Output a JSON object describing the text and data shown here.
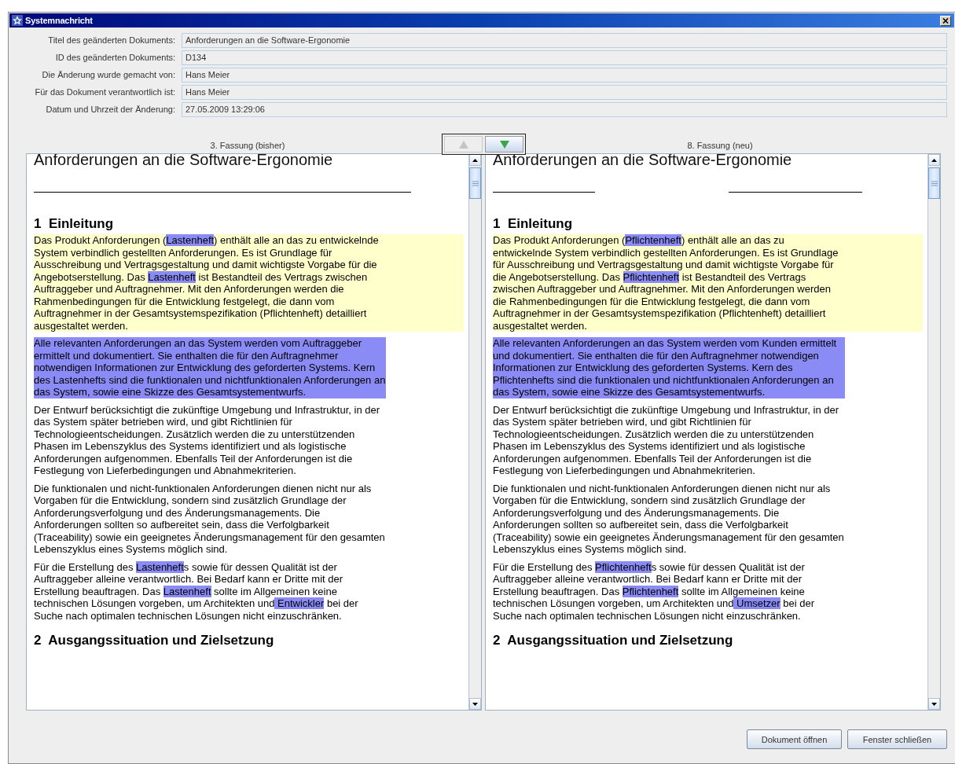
{
  "window": {
    "title": "Systemnachricht"
  },
  "fields": [
    {
      "label": "Titel des geänderten Dokuments:",
      "value": "Anforderungen an die Software-Ergonomie"
    },
    {
      "label": "ID des geänderten Dokuments:",
      "value": "D134"
    },
    {
      "label": "Die Änderung wurde gemacht von:",
      "value": "Hans Meier"
    },
    {
      "label": "Für das Dokument verantwortlich ist:",
      "value": "Hans Meier"
    },
    {
      "label": "Datum und Uhrzeit der Änderung:",
      "value": "27.05.2009 13:29:06"
    }
  ],
  "navigation": {
    "previous": {
      "disabled": true
    },
    "next": {
      "disabled": false
    }
  },
  "versions": [
    {
      "label": "3. Fassung (bisher)",
      "title": "Anforderungen an die Software-Ergonomie",
      "title_rule": {
        "kind": "full"
      },
      "sections": [
        {
          "heading": "1  Einleitung",
          "paragraphs": [
            {
              "kind": "changed",
              "segments": [
                {
                  "text": "Das Produkt Anforderungen (",
                  "marked": false
                },
                {
                  "text": "Lastenheft",
                  "marked": true
                },
                {
                  "text": ") enthält alle an das zu entwickelnde System verbindlich gestellten Anforderungen. Es ist Grundlage für Ausschreibung und Vertragsgestaltung und damit wichtigste Vorgabe für die Angebotserstellung. Das ",
                  "marked": false
                },
                {
                  "text": "Lastenheft",
                  "marked": true
                },
                {
                  "text": " ist Bestandteil des Vertrags zwischen Auftraggeber und Auftragnehmer. Mit den Anforderungen werden die Rahmenbedingungen für die Entwicklung festgelegt, die dann vom Auftragnehmer in der Gesamtsystemspezifikation (Pflichtenheft) detailliert ausgestaltet werden.",
                  "marked": false
                }
              ]
            },
            {
              "kind": "selected",
              "segments": [
                {
                  "text": "Alle relevanten Anforderungen an das System werden vom Auftraggeber ermittelt und dokumentiert. Sie enthalten die für den Auftragnehmer notwendigen Informationen zur Entwicklung des geforderten Systems. Kern des Lastenhefts sind die funktionalen und nichtfunktionalen Anforderungen an das System, sowie eine Skizze des Gesamtsystementwurfs.",
                  "marked": false
                }
              ]
            },
            {
              "kind": "plain",
              "segments": [
                {
                  "text": "Der Entwurf berücksichtigt die zukünftige Umgebung und Infrastruktur, in der das System später betrieben wird, und gibt Richtlinien für Technologieentscheidungen. Zusätzlich werden die zu unterstützenden Phasen im Lebenszyklus des Systems identifiziert und als logistische Anforderungen aufgenommen. Ebenfalls Teil der Anforderungen ist die Festlegung von Lieferbedingungen und Abnahmekriterien.",
                  "marked": false
                }
              ]
            },
            {
              "kind": "plain",
              "segments": [
                {
                  "text": "Die funktionalen und nicht-funktionalen Anforderungen dienen nicht nur als Vorgaben für die Entwicklung, sondern sind zusätzlich Grundlage der Anforderungsverfolgung und des Änderungsmanagements. Die Anforderungen sollten so aufbereitet sein, dass die Verfolgbarkeit (Traceability) sowie ein geeignetes Änderungsmanagement für den gesamten Lebenszyklus eines Systems möglich sind.",
                  "marked": false
                }
              ]
            },
            {
              "kind": "plain",
              "segments": [
                {
                  "text": "Für die Erstellung des ",
                  "marked": false
                },
                {
                  "text": "Lastenheft",
                  "marked": true
                },
                {
                  "text": "s sowie für dessen Qualität ist der Auftraggeber alleine verantwortlich. Bei Bedarf kann er Dritte mit der Erstellung beauftragen. Das ",
                  "marked": false
                },
                {
                  "text": "Lastenheft",
                  "marked": true
                },
                {
                  "text": " sollte im Allgemeinen keine technischen Lösungen vorgeben, um Architekten und",
                  "marked": false
                },
                {
                  "text": " Entwickler",
                  "marked": true
                },
                {
                  "text": " bei der Suche nach optimalen technischen Lösungen nicht einzuschränken.",
                  "marked": false
                }
              ]
            }
          ]
        },
        {
          "heading": "2  Ausgangssituation und Zielsetzung"
        }
      ]
    },
    {
      "label": "8. Fassung (neu)",
      "title": "Anforderungen an die Software-Ergonomie",
      "title_rule": {
        "kind": "split"
      },
      "sections": [
        {
          "heading": "1  Einleitung",
          "paragraphs": [
            {
              "kind": "changed",
              "segments": [
                {
                  "text": "Das Produkt Anforderungen (",
                  "marked": false
                },
                {
                  "text": "Pflichtenheft",
                  "marked": true
                },
                {
                  "text": ") enthält alle an das zu entwickelnde System verbindlich gestellten Anforderungen. Es ist Grundlage für Ausschreibung und Vertragsgestaltung und damit wichtigste Vorgabe für die Angebotserstellung. Das ",
                  "marked": false
                },
                {
                  "text": "Pflichtenheft",
                  "marked": true
                },
                {
                  "text": " ist Bestandteil des Vertrags zwischen Auftraggeber und Auftragnehmer. Mit den Anforderungen werden die Rahmenbedingungen für die Entwicklung festgelegt, die dann vom Auftragnehmer in der Gesamtsystemspezifikation (Pflichtenheft) detailliert ausgestaltet werden.",
                  "marked": false
                }
              ]
            },
            {
              "kind": "selected",
              "segments": [
                {
                  "text": "Alle relevanten Anforderungen an das System werden vom Kunden ermittelt und dokumentiert. Sie enthalten die für den Auftragnehmer notwendigen Informationen zur Entwicklung des geforderten Systems. Kern des Pflichtenhefts sind die funktionalen und nichtfunktionalen Anforderungen an das System, sowie eine Skizze des Gesamtsystementwurfs.",
                  "marked": false
                }
              ]
            },
            {
              "kind": "plain",
              "segments": [
                {
                  "text": "Der Entwurf berücksichtigt die zukünftige Umgebung und Infrastruktur, in der das System später betrieben wird, und gibt Richtlinien für Technologieentscheidungen. Zusätzlich werden die zu unterstützenden Phasen im Lebenszyklus des Systems identifiziert und als logistische Anforderungen aufgenommen. Ebenfalls Teil der Anforderungen ist die Festlegung von Lieferbedingungen und Abnahmekriterien.",
                  "marked": false
                }
              ]
            },
            {
              "kind": "plain",
              "segments": [
                {
                  "text": "Die funktionalen und nicht-funktionalen Anforderungen dienen nicht nur als Vorgaben für die Entwicklung, sondern sind zusätzlich Grundlage der Anforderungsverfolgung und des Änderungsmanagements. Die Anforderungen sollten so aufbereitet sein, dass die Verfolgbarkeit (Traceability) sowie ein geeignetes Änderungsmanagement für den gesamten Lebenszyklus eines Systems möglich sind.",
                  "marked": false
                }
              ]
            },
            {
              "kind": "plain",
              "segments": [
                {
                  "text": "Für die Erstellung des ",
                  "marked": false
                },
                {
                  "text": "Pflichtenheft",
                  "marked": true
                },
                {
                  "text": "s sowie für dessen Qualität ist der Auftraggeber alleine verantwortlich. Bei Bedarf kann er Dritte mit der Erstellung beauftragen. Das ",
                  "marked": false
                },
                {
                  "text": "Pflichtenheft",
                  "marked": true
                },
                {
                  "text": " sollte im Allgemeinen keine technischen Lösungen vorgeben, um Architekten und",
                  "marked": false
                },
                {
                  "text": " Umsetzer",
                  "marked": true
                },
                {
                  "text": " bei der Suche nach optimalen technischen Lösungen nicht einzuschränken.",
                  "marked": false
                }
              ]
            }
          ]
        },
        {
          "heading": "2  Ausgangssituation und Zielsetzung"
        }
      ]
    }
  ],
  "buttons": [
    "Dokument öffnen",
    "Fenster schließen"
  ]
}
